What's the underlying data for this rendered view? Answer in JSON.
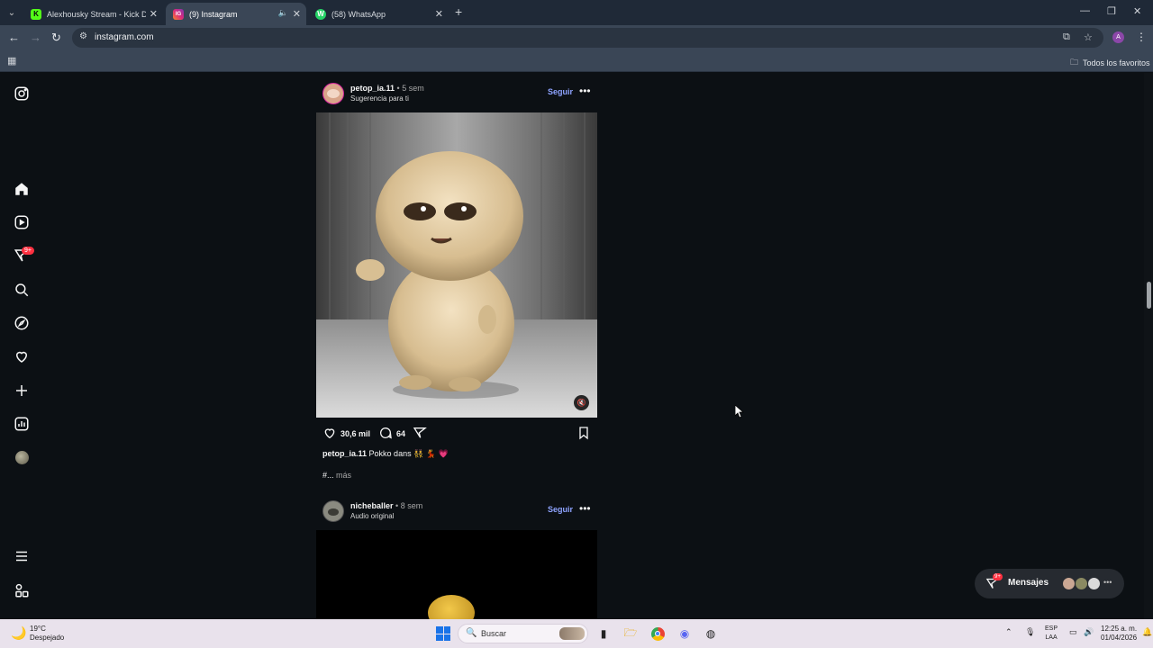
{
  "browser": {
    "tabs": [
      {
        "title": "Alexhousky Stream - Kick Dashb",
        "favicon": "K",
        "color": "#53fc18"
      },
      {
        "title": "(9) Instagram",
        "favicon": "IG",
        "color": "#d62976"
      },
      {
        "title": "(58) WhatsApp",
        "favicon": "W",
        "color": "#25d366"
      }
    ],
    "url": "instagram.com",
    "profile_initial": "A",
    "bookmarks_folder": "Todos los favoritos"
  },
  "sidebar": {
    "notifications_badge": "9+"
  },
  "posts": [
    {
      "username": "petop_ia.11",
      "time": "• 5 sem",
      "subtitle": "Sugerencia para ti",
      "follow": "Seguir",
      "likes": "30,6 mil",
      "comments": "64",
      "caption_user": "petop_ia.11",
      "caption_text": "Pokko dans 👯 💃 💗",
      "hashtags": "#...",
      "more": "más"
    },
    {
      "username": "nicheballer",
      "time": "• 8 sem",
      "subtitle": "Audio original",
      "follow": "Seguir"
    }
  ],
  "messages": {
    "label": "Mensajes",
    "badge": "9+"
  },
  "taskbar": {
    "temperature": "19°C",
    "weather": "Despejado",
    "search_placeholder": "Buscar",
    "language_top": "ESP",
    "language_bottom": "LAA",
    "time": "12:25 a. m.",
    "date": "01/04/2026"
  }
}
